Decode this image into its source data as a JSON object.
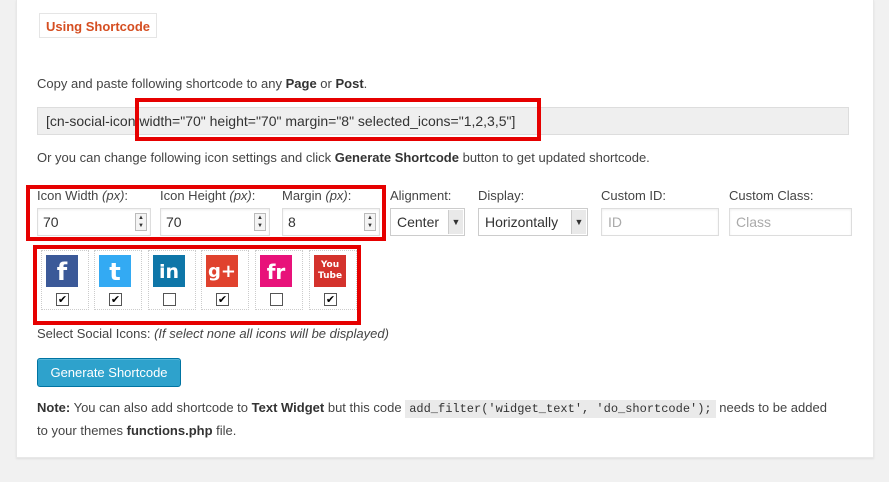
{
  "section_title": "Using Shortcode",
  "intro": {
    "prefix": "Copy and paste following shortcode to any ",
    "page": "Page",
    "or": " or ",
    "post": "Post",
    "suffix": "."
  },
  "shortcode": "[cn-social-icon width=\"70\" height=\"70\" margin=\"8\" selected_icons=\"1,2,3,5\"]",
  "or_text": {
    "prefix": "Or you can change following icon settings and click ",
    "button_name": "Generate Shortcode",
    "suffix": " button to get updated shortcode."
  },
  "fields": {
    "icon_width": {
      "label": "Icon Width ",
      "unit": "(px)",
      "colon": ":",
      "value": "70"
    },
    "icon_height": {
      "label": "Icon Height ",
      "unit": "(px)",
      "colon": ":",
      "value": "70"
    },
    "margin": {
      "label": "Margin ",
      "unit": "(px)",
      "colon": ":",
      "value": "8"
    },
    "alignment": {
      "label": "Alignment:",
      "value": "Center"
    },
    "display": {
      "label": "Display:",
      "value": "Horizontally"
    },
    "custom_id": {
      "label": "Custom ID:",
      "placeholder": "ID"
    },
    "custom_class": {
      "label": "Custom Class:",
      "placeholder": "Class"
    }
  },
  "social_icons": [
    {
      "name": "facebook-icon",
      "glyph": "f",
      "color": "#3b5998",
      "checked": true
    },
    {
      "name": "twitter-icon",
      "glyph": "t",
      "color": "#33aaf3",
      "checked": true
    },
    {
      "name": "linkedin-icon",
      "glyph": "in",
      "color": "#0e76a8",
      "checked": false
    },
    {
      "name": "google-plus-icon",
      "glyph": "g+",
      "color": "#e0422e",
      "checked": true
    },
    {
      "name": "friendfeed-icon",
      "glyph": "fr",
      "color": "#e8127a",
      "checked": false
    },
    {
      "name": "youtube-icon",
      "glyph": "You Tube",
      "color": "#d4322c",
      "checked": true
    }
  ],
  "select_icons_text": {
    "label": "Select Social Icons: ",
    "hint": "(If select none all icons will be displayed)"
  },
  "generate_button": "Generate Shortcode",
  "note": {
    "label": "Note:",
    "text1": " You can also add shortcode to ",
    "text_widget": "Text Widget",
    "text2": " but this code ",
    "code": "add_filter('widget_text', 'do_shortcode');",
    "text3": " needs to be added",
    "text4": "to your themes ",
    "file": "functions.php",
    "text5": " file."
  },
  "colors": {
    "accent": "#d54e21",
    "button": "#2ea2cc",
    "highlight": "#e60000"
  }
}
